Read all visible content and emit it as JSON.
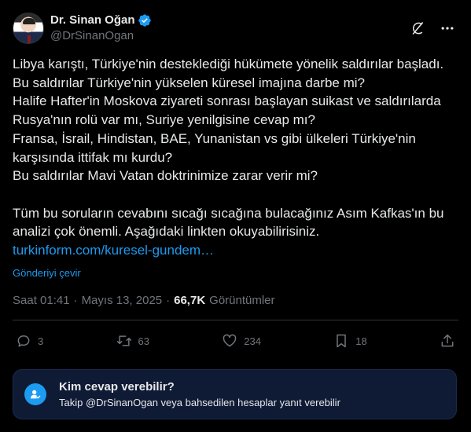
{
  "author": {
    "display_name": "Dr. Sinan Oğan",
    "handle": "@DrSinanOgan",
    "verified": true,
    "avatar_icon": "user-avatar"
  },
  "header_actions": {
    "grok_icon": "grok-icon",
    "more_icon": "more-horizontal-icon"
  },
  "post": {
    "paragraph1": "Libya karıştı, Türkiye'nin desteklediği hükümete yönelik saldırılar başladı.\nBu saldırılar Türkiye'nin yükselen küresel imajına darbe mi?\nHalife Hafter'in Moskova ziyareti sonrası başlayan suikast ve saldırılarda Rusya'nın rolü var mı, Suriye yenilgisine cevap mı?\nFransa, İsrail, Hindistan, BAE, Yunanistan vs gibi ülkeleri Türkiye'nin karşısında ittifak mı kurdu?\nBu saldırılar Mavi Vatan doktrinimize zarar verir mi?",
    "paragraph2": "Tüm bu soruların cevabını sıcağı sıcağına bulacağınız Asım Kafkas'ın bu analizi çok önemli. Aşağıdaki linkten okuyabilirisiniz.",
    "link_text": "turkinform.com/kuresel-gundem…",
    "translate_label": "Gönderiyi çevir"
  },
  "meta": {
    "time": "Saat 01:41",
    "separator": "·",
    "date": "Mayıs 13, 2025",
    "views_count": "66,7K",
    "views_label": "Görüntümler"
  },
  "actions": {
    "replies": "3",
    "reposts": "63",
    "likes": "234",
    "bookmarks": "18"
  },
  "reply_restriction": {
    "title": "Kim cevap verebilir?",
    "description": "Takip @DrSinanOgan veya bahsedilen hesaplar yanıt verebilir"
  },
  "colors": {
    "background": "#000000",
    "accent": "#1d9bf0",
    "muted": "#71767b",
    "text": "#e7e9ea",
    "reply_box": "#0f1a35"
  }
}
